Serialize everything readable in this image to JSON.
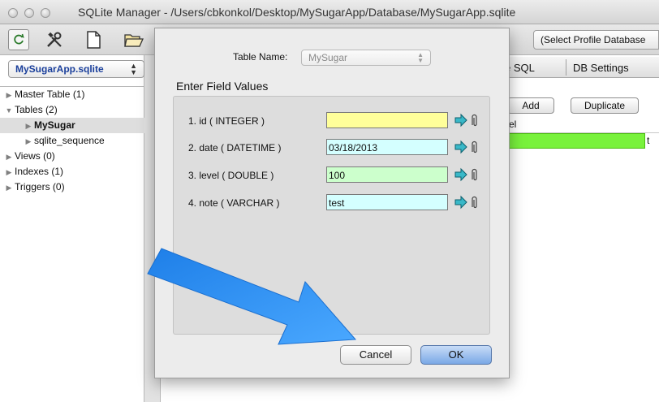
{
  "window": {
    "title": "SQLite Manager - /Users/cbkonkol/Desktop/MySugarApp/Database/MySugarApp.sqlite"
  },
  "toolbar": {
    "icons": [
      "refresh-icon",
      "tools-icon",
      "new-database-icon",
      "open-database-icon"
    ],
    "profile_select": "(Select Profile Database"
  },
  "sidebar": {
    "database_select": "MySugarApp.sqlite",
    "tree": [
      {
        "label": "Master Table (1)",
        "expanded": false,
        "level": 0
      },
      {
        "label": "Tables (2)",
        "expanded": true,
        "level": 0
      },
      {
        "label": "MySugar",
        "expanded": false,
        "level": 1,
        "selected": true
      },
      {
        "label": "sqlite_sequence",
        "expanded": false,
        "level": 1
      },
      {
        "label": "Views (0)",
        "expanded": false,
        "level": 0
      },
      {
        "label": "Indexes (1)",
        "expanded": false,
        "level": 0
      },
      {
        "label": "Triggers (0)",
        "expanded": false,
        "level": 0
      }
    ]
  },
  "main": {
    "tabs": [
      "e SQL",
      "DB Settings"
    ],
    "buttons": {
      "add": "Add",
      "duplicate": "Duplicate"
    },
    "column_header": "el",
    "cell_fragment": "t"
  },
  "dialog": {
    "table_name_label": "Table Name:",
    "table_name_value": "MySugar",
    "section_title": "Enter Field Values",
    "fields": [
      {
        "label": "1. id ( INTEGER )",
        "value": "",
        "color": "#ffff9a"
      },
      {
        "label": "2. date ( DATETIME )",
        "value": "03/18/2013",
        "color": "#d4ffff"
      },
      {
        "label": "3. level ( DOUBLE )",
        "value": "100",
        "color": "#ccffcc"
      },
      {
        "label": "4. note ( VARCHAR )",
        "value": "test",
        "color": "#d4ffff"
      }
    ],
    "cancel_label": "Cancel",
    "ok_label": "OK"
  },
  "annotation": {
    "arrow_color": "#2f8ff0"
  }
}
